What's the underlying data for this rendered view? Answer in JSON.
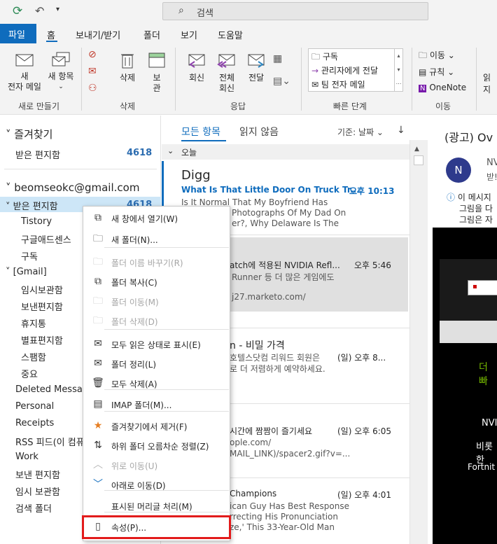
{
  "search": {
    "placeholder": "검색"
  },
  "ribbon_tabs": [
    "파일",
    "홈",
    "보내기/받기",
    "폴더",
    "보기",
    "도움말"
  ],
  "ribbon": {
    "new_mail": "새\n전자 메일",
    "new_items": "새 항목",
    "delete": "삭제",
    "archive": "보\n관",
    "reply": "회신",
    "reply_all": "전체\n회신",
    "forward": "전달",
    "quick_steps": [
      "구독",
      "관리자에게 전달",
      "팀 전자 메일"
    ],
    "move": "이동",
    "rules": "규칙",
    "onenote": "OneNote",
    "read": "읽지",
    "groups": [
      "새로 만들기",
      "삭제",
      "응답",
      "빠른 단계",
      "이동"
    ]
  },
  "nav": {
    "favorites": "즐겨찾기",
    "fav_inbox": "받은 편지함",
    "fav_inbox_count": "4618",
    "account": "beomseokc@gmail.com",
    "inbox": "받은 편지함",
    "inbox_count": "4618",
    "folders": [
      "Tistory",
      "구글애드센스",
      "구독"
    ],
    "gmail": "[Gmail]",
    "gmail_folders": [
      "임시보관함",
      "보낸편지함",
      "휴지통",
      "별표편지함",
      "스팸함",
      "중요"
    ],
    "other": [
      "Deleted Messag",
      "Personal",
      "Receipts",
      "RSS 피드(이 컴퓨",
      "Work",
      "보낸 편지함",
      "임시 보관함",
      "검색 폴더"
    ]
  },
  "list": {
    "tab_all": "모든 항목",
    "tab_unread": "읽지 않음",
    "sort": "기준: 날짜",
    "group_today": "오늘",
    "m1_sender": "Digg",
    "m1_subject": "What Is That Little Door On Truck Tr...",
    "m1_time": "오후 10:13",
    "m1_preview1": "Is It Normal That My Boyfriend Has",
    "m1_preview2": "Photographs Of My Dad On",
    "m1_preview3": "er?, Why Delaware Is The",
    "m2_subject": "atch에 적용된 NVIDIA Refl...",
    "m2_time": "오후 5:46",
    "m2_preview1": "Runner 등 더 많은 게임에도",
    "m2_preview2": "j27.marketo.com/",
    "m3_subject": "n - 비밀 가격",
    "m3_time": "(일) 오후 8...",
    "m3_preview1": "호텔스닷컴 리워드 회원은",
    "m3_preview2": "로 더 저렴하게 예약하세요.",
    "m4_subject": "시간에 짬짬이 즐기세요",
    "m4_time": "(일) 오후 6:05",
    "m4_preview1": "ople.com/",
    "m4_preview2": "MAIL_LINK)/spacer2.gif?v=...",
    "m5_subject": "Champions",
    "m5_time": "(일) 오후 4:01",
    "m5_preview1": "ican Guy Has Best Response",
    "m5_preview2": "rrecting His Pronunciation",
    "m5_preview3": "ze,' This 33-Year-Old Man"
  },
  "reading": {
    "title": "(광고) Ov",
    "avatar": "N",
    "sender": "NV",
    "sender2": "받!",
    "info1": "이 메시지",
    "info2": "그림을 다",
    "info3": "그림은 자",
    "promo1": "더 빠",
    "promo2": "NVI",
    "promo3": "비롯한",
    "promo4": "Fortnit"
  },
  "menu": [
    {
      "icon": "new-window-icon",
      "glyph": "⧉",
      "label": "새 창에서 열기(W)",
      "disabled": false
    },
    {
      "icon": "new-folder-icon",
      "glyph": "🗀",
      "label": "새 폴더(N)...",
      "disabled": false
    },
    {
      "icon": "rename-folder-icon",
      "glyph": "🗀",
      "label": "폴더 이름 바꾸기(R)",
      "disabled": true
    },
    {
      "icon": "copy-folder-icon",
      "glyph": "⧉",
      "label": "폴더 복사(C)",
      "disabled": false
    },
    {
      "icon": "move-folder-icon",
      "glyph": "🗀",
      "label": "폴더 이동(M)",
      "disabled": true
    },
    {
      "icon": "delete-folder-icon",
      "glyph": "🗀",
      "label": "폴더 삭제(D)",
      "disabled": true
    },
    {
      "icon": "mark-read-icon",
      "glyph": "✉",
      "label": "모두 읽은 상태로 표시(E)",
      "disabled": false
    },
    {
      "icon": "clean-folder-icon",
      "glyph": "✉",
      "label": "폴더 정리(L)",
      "disabled": false
    },
    {
      "icon": "delete-all-icon",
      "glyph": "🗑",
      "label": "모두 삭제(A)",
      "disabled": false
    },
    {
      "icon": "imap-folder-icon",
      "glyph": "▤",
      "label": "IMAP 폴더(M)...",
      "disabled": false
    },
    {
      "icon": "remove-favorite-icon",
      "glyph": "★",
      "label": "즐겨찾기에서 제거(F)",
      "disabled": false
    },
    {
      "icon": "sort-subfolders-icon",
      "glyph": "⇅",
      "label": "하위 폴더 오름차순 정렬(Z)",
      "disabled": false
    },
    {
      "icon": "move-up-icon",
      "glyph": "︿",
      "label": "위로 이동(U)",
      "disabled": true
    },
    {
      "icon": "move-down-icon",
      "glyph": "﹀",
      "label": "아래로 이동(D)",
      "disabled": false
    },
    {
      "icon": "",
      "glyph": "",
      "label": "표시된 머리글 처리(M)",
      "disabled": false
    },
    {
      "icon": "properties-icon",
      "glyph": "▯",
      "label": "속성(P)...",
      "disabled": false
    }
  ],
  "colors": {
    "accent": "#0f6cbd",
    "highlight": "#e21b1b",
    "link": "#2b6cb0"
  }
}
